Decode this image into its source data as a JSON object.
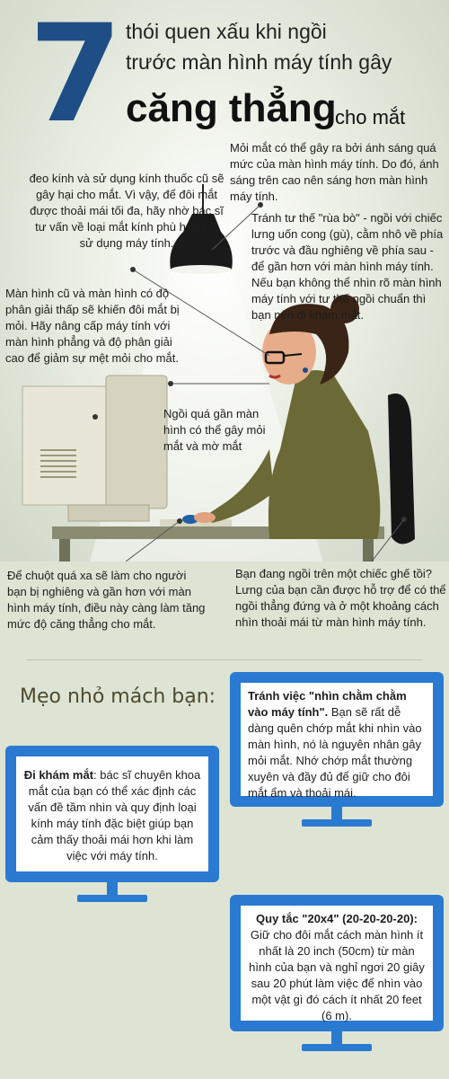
{
  "header": {
    "number": "7",
    "line1": "thói quen xấu khi ngồi",
    "line2": "trước màn hình máy tính gây",
    "line3": "căng thẳng",
    "line4": "cho mắt"
  },
  "notes": {
    "light": "Mỏi mắt có thể gây ra bởi ánh sáng quá mức của màn hình máy tính. Do đó, ánh sáng trên cao nên sáng hơn màn hình máy tính.",
    "glasses": "đeo kính và sử dụng kính thuốc cũ sẽ gây hại cho mắt. Vì vậy, để đôi mắt được thoải mái tối đa, hãy nhờ bác sĩ tư vấn về loại mắt kính phù hợp khi sử dụng máy tính.",
    "posture": "Tránh tư thế \"rùa bò\" - ngồi với chiếc lưng uốn cong (gù), cằm nhô về phía trước và đầu nghiêng về phía sau - để gần hơn với màn hình máy tính. Nếu bạn không thể nhìn rõ màn hình máy tính với tư thế ngồi chuẩn thì bạn nên đi khám mắt.",
    "old_monitor": "Màn hình cũ và màn hình có độ phân giải thấp sẽ khiến đôi mắt bị mỏi. Hãy nâng cấp máy tính với màn hình phẳng và độ phân giải cao để giảm sự mệt mỏi cho mắt.",
    "too_close": "Ngồi quá gần màn hình có thể gây mỏi mắt và mờ mắt",
    "mouse": "Để chuột quá xa sẽ làm cho người bạn bị nghiêng và gần hơn với màn hình máy tính, điều này càng làm tăng mức độ căng thẳng cho mắt.",
    "chair": "Bạn đang ngồi trên một chiếc ghế tồi? Lưng của bạn cần được hỗ trợ để có thể ngồi thẳng đứng và ở một khoảng cách nhìn thoải mái từ màn hình máy tính."
  },
  "tips": {
    "title": "Mẹo nhỏ mách bạn:",
    "tip1_bold": "Tránh việc \"nhìn chằm chằm vào máy tính\".",
    "tip1_text": " Bạn sẽ rất dễ dàng quên chớp mắt khi nhìn vào màn hình, nó là nguyên nhân gây mỏi mắt. Nhớ chớp mắt thường xuyên và đầy đủ để giữ cho đôi mắt ẩm và thoải mái.",
    "tip2_bold": "Đi khám mắt",
    "tip2_text": ": bác sĩ chuyên khoa mắt của bạn có thể xác định các vấn đề tầm nhìn và quy định loại kính máy tính đặc biệt giúp bạn cảm thấy thoải mái hơn khi làm việc với máy tính.",
    "tip3_bold": "Quy tắc \"20x4\" (20-20-20-20):",
    "tip3_text": " Giữ cho đôi mắt cách màn hình ít nhất là 20 inch (50cm) từ màn hình của bạn và nghỉ ngơi 20 giây sau 20 phút làm việc để nhìn vào một vật gì đó cách ít nhất 20 feet (6 m)."
  },
  "colors": {
    "brand_blue": "#1f4d86",
    "monitor_blue": "#2a7ad2",
    "shirt": "#6b6a37"
  }
}
